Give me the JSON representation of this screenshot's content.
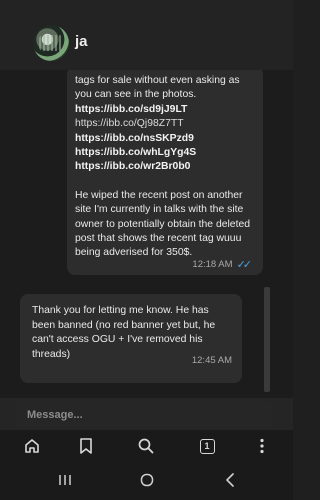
{
  "header": {
    "contact_name": "ja",
    "avatar_icon": "profile-photo"
  },
  "messages": [
    {
      "direction": "outgoing",
      "lines": {
        "intro": "tags for sale without even asking as you can see in the photos.",
        "links": [
          "https://ibb.co/sd9jJ9LT",
          "https://ibb.co/Qj98Z7TT",
          "https://ibb.co/nsSKPzd9",
          "https://ibb.co/whLgYg4S",
          "https://ibb.co/wr2Br0b0"
        ],
        "body": "He wiped the recent post on another site I'm currently in talks with the site owner to potentially obtain the deleted post that shows the recent tag wuuu being adverised for 350$."
      },
      "time": "12:18 AM",
      "status_icon": "double-check-icon",
      "status_color": "#4aa3e0"
    },
    {
      "direction": "incoming",
      "text": "Thank you for letting me know. He has been banned (no red banner yet but, he can't access OGU + I've removed his threads)",
      "time": "12:45 AM"
    }
  ],
  "composer": {
    "placeholder": "Message..."
  },
  "navbar": {
    "home_icon": "home-icon",
    "bookmark_icon": "bookmark-icon",
    "search_icon": "search-icon",
    "tab_count": "1",
    "menu_icon": "more-vertical-icon"
  },
  "system_nav": {
    "recents_icon": "recents-icon",
    "home_icon": "circle-home-icon",
    "back_icon": "back-chevron-icon"
  },
  "colors": {
    "background": "#1c1c1c",
    "bubble": "#2d2d2d",
    "read_ticks": "#4aa3e0"
  }
}
